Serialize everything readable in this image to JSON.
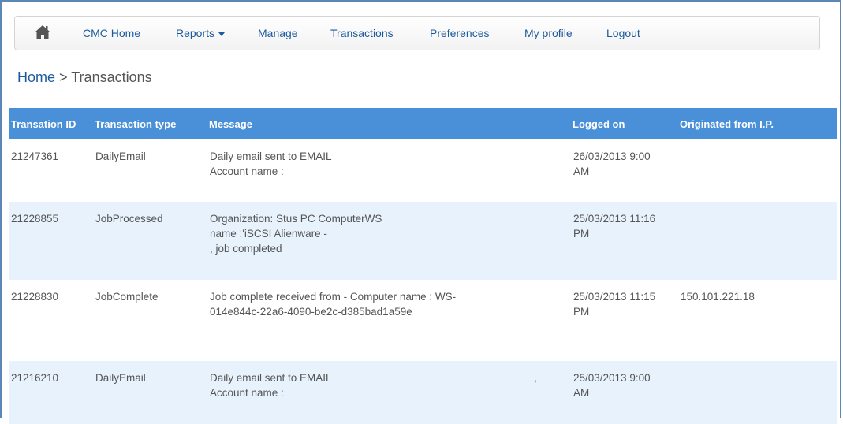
{
  "nav": {
    "items": [
      "CMC Home",
      "Reports",
      "Manage",
      "Transactions",
      "Preferences",
      "My profile",
      "Logout"
    ]
  },
  "breadcrumb": {
    "home": "Home",
    "separator": ">",
    "current": "Transactions"
  },
  "table": {
    "headers": [
      "Transation ID",
      "Transaction type",
      "Message",
      "Logged on",
      "Originated from I.P."
    ],
    "rows": [
      {
        "id": "21247361",
        "type": "DailyEmail",
        "message_lines": [
          "Daily email sent to EMAIL",
          "Account name :"
        ],
        "extra": "",
        "logged_lines": [
          "26/03/2013 9:00",
          "AM"
        ],
        "ip": ""
      },
      {
        "id": "21228855",
        "type": "JobProcessed",
        "message_lines": [
          "Organization: Stus PC ComputerWS",
          "name :'iSCSI Alienware -",
          ", job completed"
        ],
        "extra": "",
        "logged_lines": [
          "25/03/2013 11:16",
          "PM"
        ],
        "ip": ""
      },
      {
        "id": "21228830",
        "type": "JobComplete",
        "message_lines": [
          "Job complete received from - Computer name : WS-",
          "014e844c-22a6-4090-be2c-d385bad1a59e"
        ],
        "extra": "",
        "logged_lines": [
          "25/03/2013 11:15",
          "PM"
        ],
        "ip": "150.101.221.18"
      },
      {
        "id": "21216210",
        "type": "DailyEmail",
        "message_lines": [
          "Daily email sent to EMAIL",
          "Account name :"
        ],
        "extra": ",",
        "logged_lines": [
          "25/03/2013 9:00",
          "AM"
        ],
        "ip": ""
      }
    ]
  },
  "colors": {
    "header_bg": "#4a90d9",
    "link": "#1c5a9e",
    "row_alt": "#e8f2fc"
  },
  "icons": [
    "home-icon",
    "caret-down-icon"
  ]
}
